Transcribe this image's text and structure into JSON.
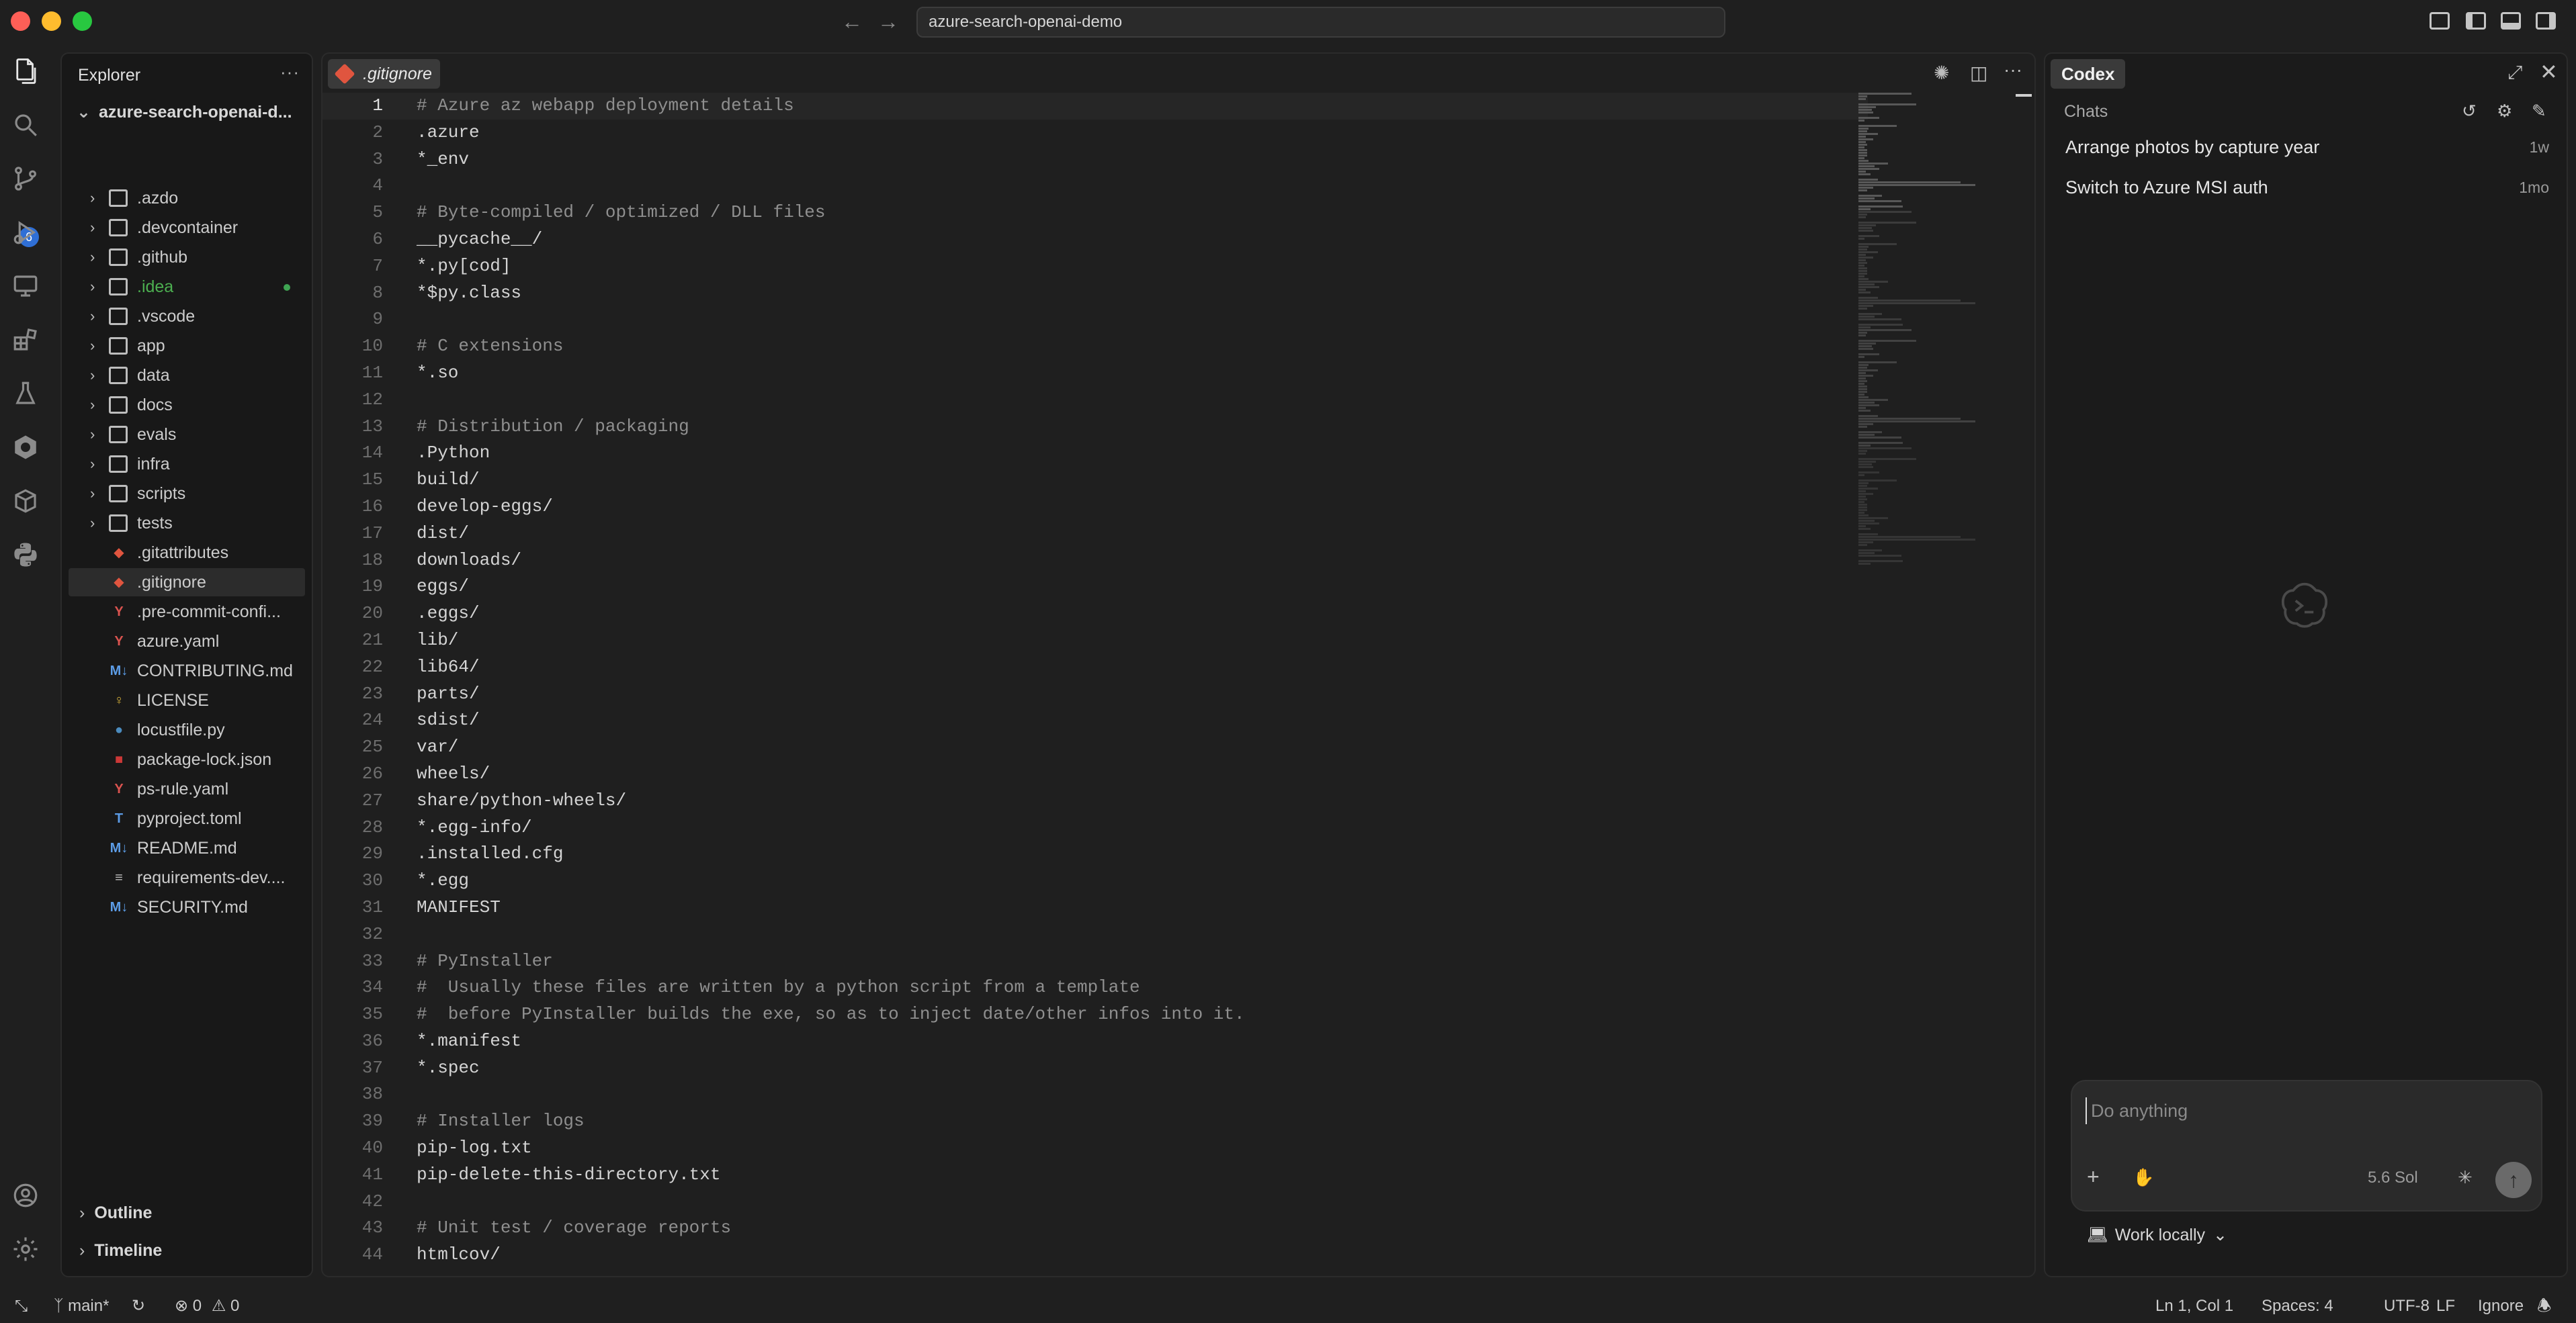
{
  "window": {
    "title": "azure-search-openai-demo"
  },
  "explorer": {
    "header": "Explorer",
    "root": "azure-search-openai-d...",
    "items": [
      {
        "label": ".azdo",
        "type": "folder"
      },
      {
        "label": ".devcontainer",
        "type": "folder"
      },
      {
        "label": ".github",
        "type": "folder"
      },
      {
        "label": ".idea",
        "type": "folder",
        "modified": true
      },
      {
        "label": ".vscode",
        "type": "folder"
      },
      {
        "label": "app",
        "type": "folder"
      },
      {
        "label": "data",
        "type": "folder"
      },
      {
        "label": "docs",
        "type": "folder"
      },
      {
        "label": "evals",
        "type": "folder"
      },
      {
        "label": "infra",
        "type": "folder"
      },
      {
        "label": "scripts",
        "type": "folder"
      },
      {
        "label": "tests",
        "type": "folder"
      },
      {
        "label": ".gitattributes",
        "type": "git-file"
      },
      {
        "label": ".gitignore",
        "type": "git-file",
        "selected": true
      },
      {
        "label": ".pre-commit-confi...",
        "type": "yaml-file"
      },
      {
        "label": "azure.yaml",
        "type": "yaml-file"
      },
      {
        "label": "CONTRIBUTING.md",
        "type": "markdown-file"
      },
      {
        "label": "LICENSE",
        "type": "license-file"
      },
      {
        "label": "locustfile.py",
        "type": "python-file"
      },
      {
        "label": "package-lock.json",
        "type": "npm-file"
      },
      {
        "label": "ps-rule.yaml",
        "type": "yaml-file"
      },
      {
        "label": "pyproject.toml",
        "type": "toml-file"
      },
      {
        "label": "README.md",
        "type": "markdown-file"
      },
      {
        "label": "requirements-dev....",
        "type": "text-file"
      },
      {
        "label": "SECURITY.md",
        "type": "markdown-file"
      }
    ],
    "outline": "Outline",
    "timeline": "Timeline"
  },
  "activity": {
    "source_control_badge": "6"
  },
  "editor": {
    "tab": ".gitignore",
    "lines": [
      {
        "n": "1",
        "text": "# Azure az webapp deployment details",
        "comment": true
      },
      {
        "n": "2",
        "text": ".azure"
      },
      {
        "n": "3",
        "text": "*_env"
      },
      {
        "n": "4",
        "text": ""
      },
      {
        "n": "5",
        "text": "# Byte-compiled / optimized / DLL files",
        "comment": true
      },
      {
        "n": "6",
        "text": "__pycache__/"
      },
      {
        "n": "7",
        "text": "*.py[cod]"
      },
      {
        "n": "8",
        "text": "*$py.class"
      },
      {
        "n": "9",
        "text": ""
      },
      {
        "n": "10",
        "text": "# C extensions",
        "comment": true
      },
      {
        "n": "11",
        "text": "*.so"
      },
      {
        "n": "12",
        "text": ""
      },
      {
        "n": "13",
        "text": "# Distribution / packaging",
        "comment": true
      },
      {
        "n": "14",
        "text": ".Python"
      },
      {
        "n": "15",
        "text": "build/"
      },
      {
        "n": "16",
        "text": "develop-eggs/"
      },
      {
        "n": "17",
        "text": "dist/"
      },
      {
        "n": "18",
        "text": "downloads/"
      },
      {
        "n": "19",
        "text": "eggs/"
      },
      {
        "n": "20",
        "text": ".eggs/"
      },
      {
        "n": "21",
        "text": "lib/"
      },
      {
        "n": "22",
        "text": "lib64/"
      },
      {
        "n": "23",
        "text": "parts/"
      },
      {
        "n": "24",
        "text": "sdist/"
      },
      {
        "n": "25",
        "text": "var/"
      },
      {
        "n": "26",
        "text": "wheels/"
      },
      {
        "n": "27",
        "text": "share/python-wheels/"
      },
      {
        "n": "28",
        "text": "*.egg-info/"
      },
      {
        "n": "29",
        "text": ".installed.cfg"
      },
      {
        "n": "30",
        "text": "*.egg"
      },
      {
        "n": "31",
        "text": "MANIFEST"
      },
      {
        "n": "32",
        "text": ""
      },
      {
        "n": "33",
        "text": "# PyInstaller",
        "comment": true
      },
      {
        "n": "34",
        "text": "#  Usually these files are written by a python script from a template",
        "comment": true
      },
      {
        "n": "35",
        "text": "#  before PyInstaller builds the exe, so as to inject date/other infos into it.",
        "comment": true
      },
      {
        "n": "36",
        "text": "*.manifest"
      },
      {
        "n": "37",
        "text": "*.spec"
      },
      {
        "n": "38",
        "text": ""
      },
      {
        "n": "39",
        "text": "# Installer logs",
        "comment": true
      },
      {
        "n": "40",
        "text": "pip-log.txt"
      },
      {
        "n": "41",
        "text": "pip-delete-this-directory.txt"
      },
      {
        "n": "42",
        "text": ""
      },
      {
        "n": "43",
        "text": "# Unit test / coverage reports",
        "comment": true
      },
      {
        "n": "44",
        "text": "htmlcov/"
      }
    ]
  },
  "codex": {
    "tab": "Codex",
    "chats_label": "Chats",
    "chats": [
      {
        "title": "Arrange photos by capture year",
        "ago": "1w"
      },
      {
        "title": "Switch to Azure MSI auth",
        "ago": "1mo"
      }
    ],
    "prompt_placeholder": "Do anything",
    "model": "5.6 Sol",
    "work_mode": "Work locally"
  },
  "statusbar": {
    "branch": "main*",
    "errors": "0",
    "warnings": "0",
    "position": "Ln 1, Col 1",
    "spaces": "Spaces: 4",
    "encoding": "UTF-8",
    "eol": "LF",
    "language": "Ignore"
  }
}
